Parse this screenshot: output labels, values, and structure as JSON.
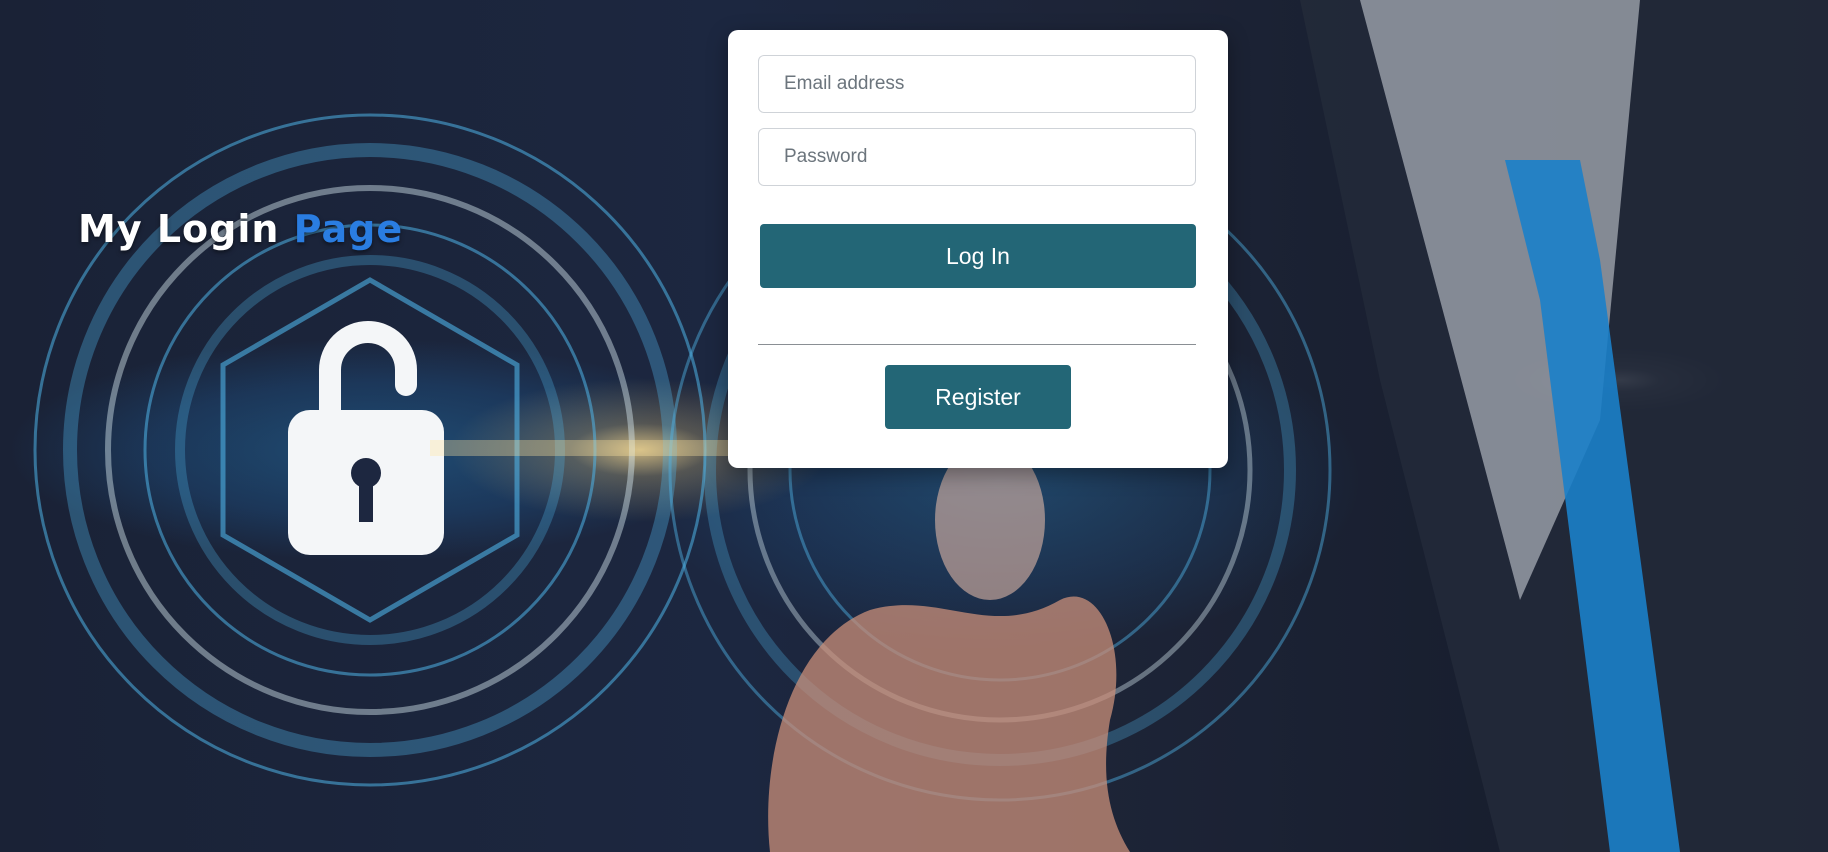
{
  "brand": {
    "title_main": "My Login",
    "title_accent": "Page",
    "accent_color": "#2a7de1"
  },
  "login_form": {
    "email_placeholder": "Email address",
    "password_placeholder": "Password",
    "login_button_label": "Log In",
    "register_button_label": "Register",
    "button_color": "#236676"
  },
  "background": {
    "description_icons": [
      "padlock-icon",
      "fingerprint-icon"
    ]
  }
}
